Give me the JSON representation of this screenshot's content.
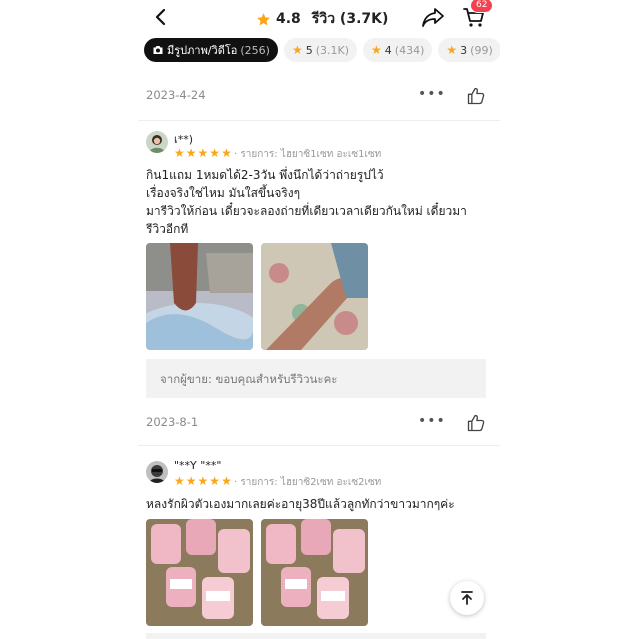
{
  "header": {
    "rating": "4.8",
    "review_label": "รีวิว (3.7K)",
    "cart_count": "62"
  },
  "filters": [
    {
      "label": "มีรูปภาพ/วิดีโอ",
      "count": "(256)",
      "icon": "camera-icon",
      "active": true
    },
    {
      "label": "5",
      "count": "(3.1K)",
      "icon": "star-icon",
      "active": false
    },
    {
      "label": "4",
      "count": "(434)",
      "icon": "star-icon",
      "active": false
    },
    {
      "label": "3",
      "count": "(99)",
      "icon": "star-icon",
      "active": false
    }
  ],
  "reviews": [
    {
      "date": "2023-4-24",
      "user": "เ**)",
      "rating": 5,
      "variant": "รายการ: ไฮยาซิ1เซท อะเซ1เซท",
      "text_lines": [
        "กิน1แถม 1หมดได้2-3วัน พึ่งนึกได้ว่าถ่ายรูปไว้",
        "เรื่องจริงใช่ไหม มันใสขึ้นจริงๆ",
        "มารีวิวให้ก่อน เดี๋ยวจะลองถ่ายที่เดียวเวลาเดียวกันใหม่ เดี๋ยวมา",
        "รีวิวอีกที"
      ],
      "seller_reply": "จากผู้ขาย: ขอบคุณสำหรับรีวิวนะคะ"
    },
    {
      "date": "2023-8-1",
      "user": "\"**Y \"**\"",
      "rating": 5,
      "variant": "รายการ: ไฮยาซิ2เซท อะเซ2เซท",
      "text_lines": [
        "หลงรักผิวตัวเองมากเลยค่ะอายุ38ปีแล้วลูกทักว่าขาวมากๆค่ะ"
      ]
    }
  ],
  "colors": {
    "star": "#f9a61a",
    "badge": "#f3424f",
    "active_chip": "#111111"
  }
}
